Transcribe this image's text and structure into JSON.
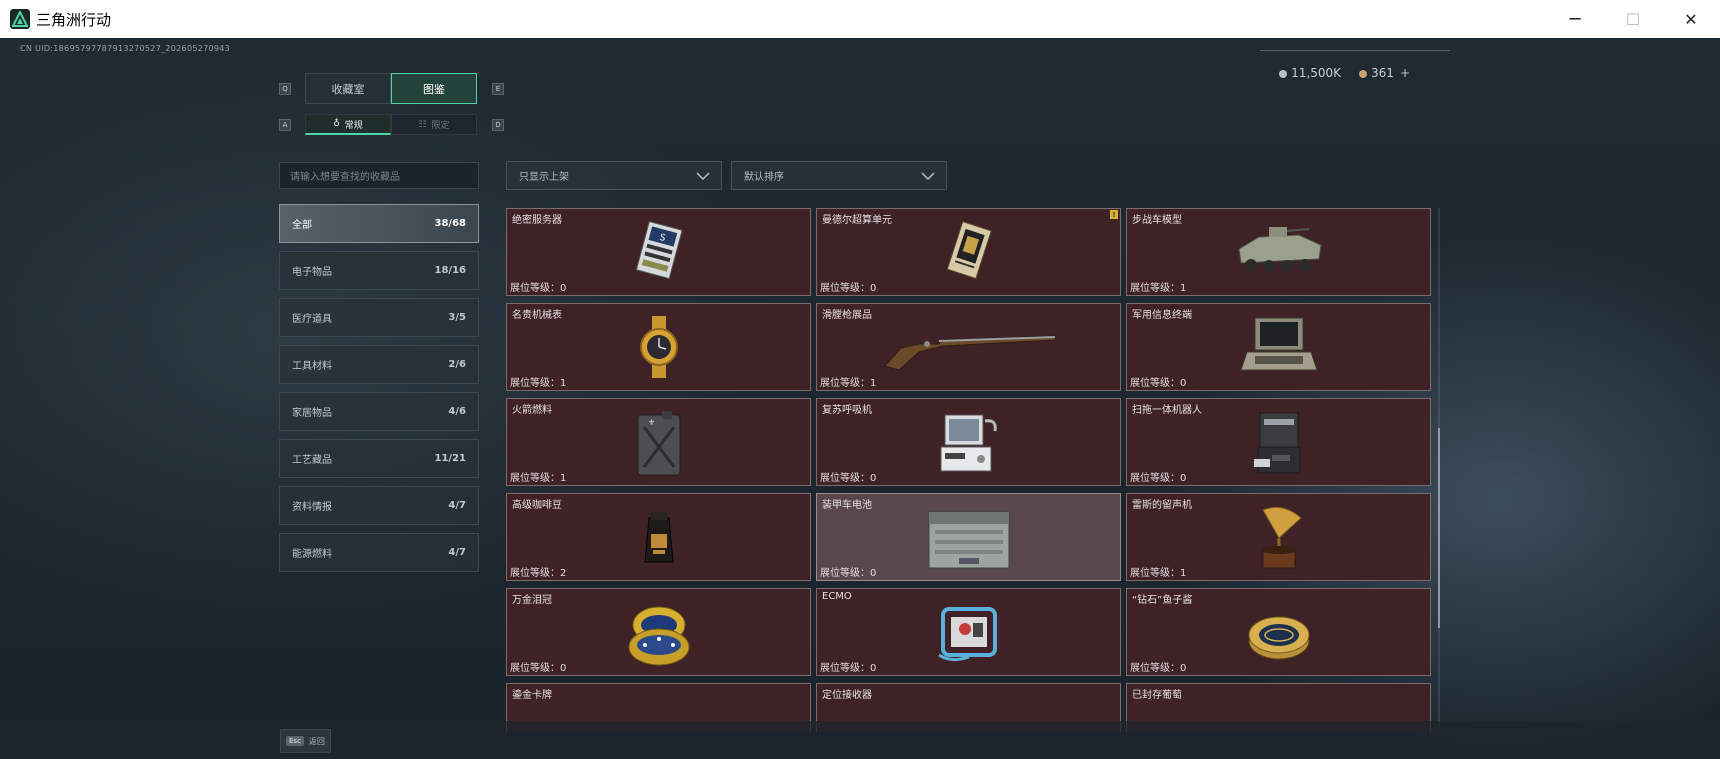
{
  "window": {
    "title": "三角洲行动",
    "min": "─",
    "max": "☐",
    "close": "✕"
  },
  "uid": "CN UID:18695797787913270527_202605270943",
  "currency": {
    "silver": "11,500K",
    "gold": "361",
    "plus": "+"
  },
  "tabs": [
    {
      "label": "收藏室",
      "active": false
    },
    {
      "label": "图鉴",
      "active": true
    }
  ],
  "keyhints": {
    "left_tab": "Q",
    "right_tab": "E",
    "left_sub": "A",
    "right_sub": "D"
  },
  "subtabs": [
    {
      "label": "常规",
      "icon": "♁",
      "active": true
    },
    {
      "label": "限定",
      "icon": "☷",
      "active": false
    }
  ],
  "search": {
    "placeholder": "请输入想要查找的收藏品"
  },
  "filters": {
    "show": "只显示上架",
    "sort": "默认排序"
  },
  "categories": [
    {
      "label": "全部",
      "count": "38/68",
      "active": true
    },
    {
      "label": "电子物品",
      "count": "18/16",
      "active": false
    },
    {
      "label": "医疗道具",
      "count": "3/5",
      "active": false
    },
    {
      "label": "工具材料",
      "count": "2/6",
      "active": false
    },
    {
      "label": "家居物品",
      "count": "4/6",
      "active": false
    },
    {
      "label": "工艺藏品",
      "count": "11/21",
      "active": false
    },
    {
      "label": "资料情报",
      "count": "4/7",
      "active": false
    },
    {
      "label": "能源燃料",
      "count": "4/7",
      "active": false
    }
  ],
  "items": [
    {
      "name": "绝密服务器",
      "level": "展位等级：0",
      "icon": "server-icon"
    },
    {
      "name": "曼德尔超算单元",
      "level": "展位等级：0",
      "icon": "chip-icon",
      "warn": "!"
    },
    {
      "name": "步战车模型",
      "level": "展位等级：1",
      "icon": "ifv-icon"
    },
    {
      "name": "名贵机械表",
      "level": "展位等级：1",
      "icon": "watch-icon"
    },
    {
      "name": "滑膛枪展品",
      "level": "展位等级：1",
      "icon": "musket-icon"
    },
    {
      "name": "军用信息终端",
      "level": "展位等级：0",
      "icon": "terminal-icon"
    },
    {
      "name": "火箭燃料",
      "level": "展位等级：1",
      "icon": "fuel-can-icon"
    },
    {
      "name": "复苏呼吸机",
      "level": "展位等级：0",
      "icon": "ventilator-icon"
    },
    {
      "name": "扫拖一体机器人",
      "level": "展位等级：0",
      "icon": "robot-icon"
    },
    {
      "name": "高级咖啡豆",
      "level": "展位等级：2",
      "icon": "coffee-icon"
    },
    {
      "name": "装甲车电池",
      "level": "展位等级：0",
      "icon": "battery-icon",
      "highlight": true
    },
    {
      "name": "雷斯的留声机",
      "level": "展位等级：1",
      "icon": "gramophone-icon"
    },
    {
      "name": "万金泪冠",
      "level": "展位等级：0",
      "icon": "egg-icon"
    },
    {
      "name": "ECMO",
      "level": "展位等级：0",
      "icon": "ecmo-icon"
    },
    {
      "name": "“钻石”鱼子酱",
      "level": "展位等级：0",
      "icon": "caviar-icon"
    },
    {
      "name": "鎏金卡牌",
      "level": "",
      "icon": "card-icon"
    },
    {
      "name": "定位接收器",
      "level": "",
      "icon": "receiver-icon"
    },
    {
      "name": "已封存葡萄",
      "level": "",
      "icon": "grape-icon"
    }
  ],
  "footer": {
    "key": "Esc",
    "label": "返回"
  }
}
